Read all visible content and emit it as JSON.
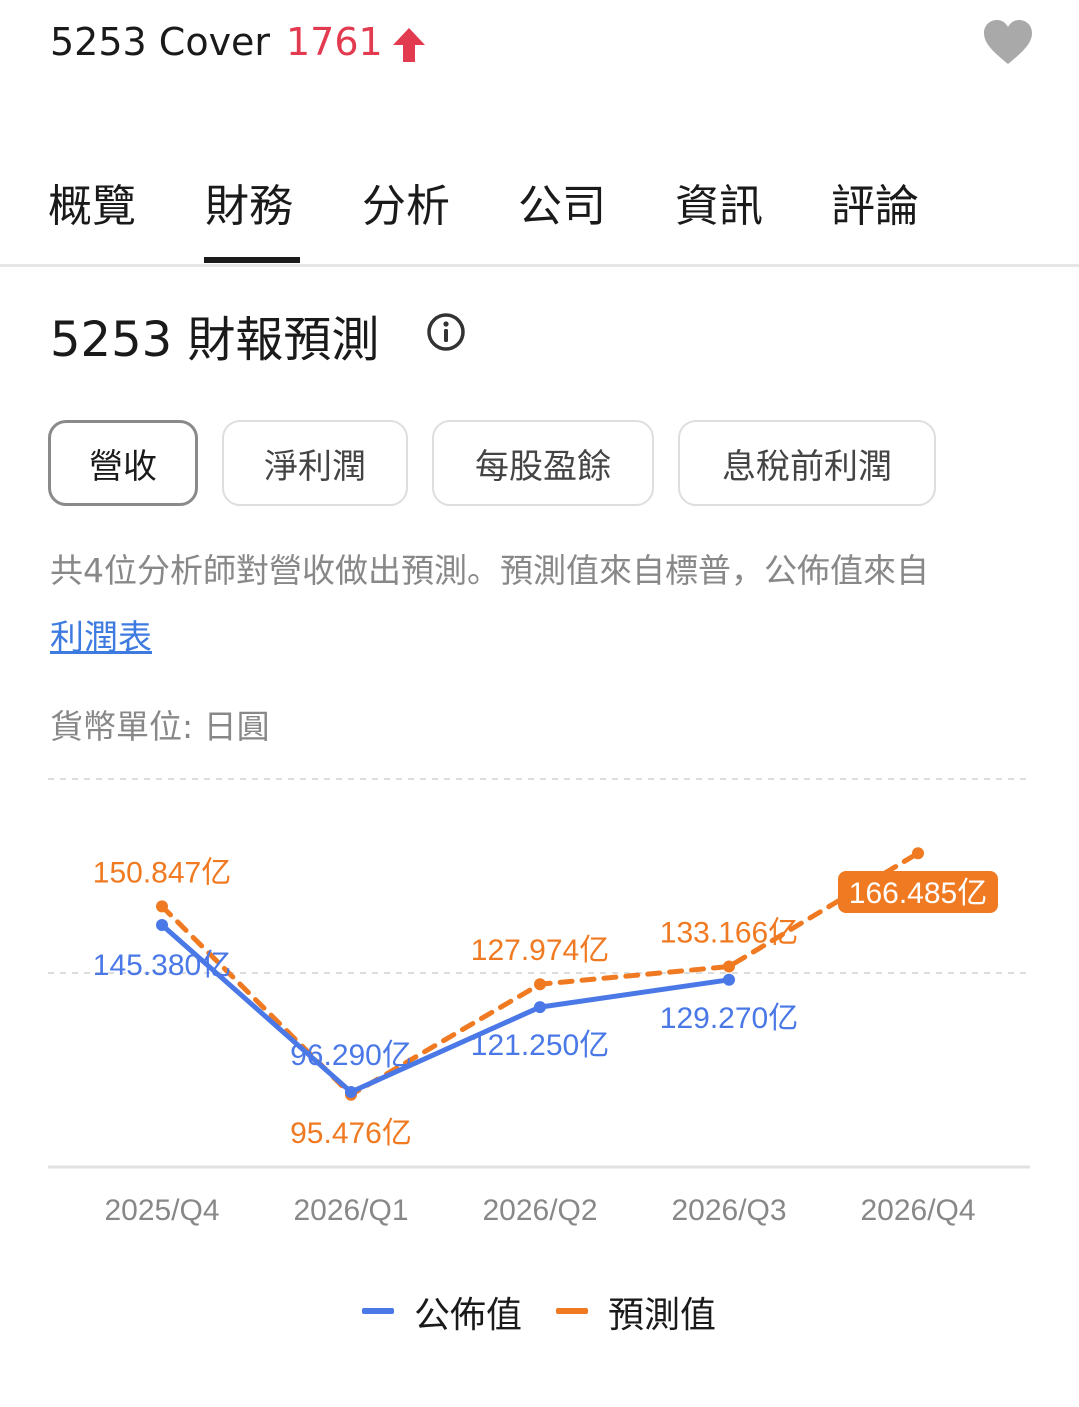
{
  "header": {
    "stock_name": "5253 Cover",
    "price": "1761",
    "price_color": "#e23a4f",
    "trend_icon": "arrow-up-icon",
    "favorite_icon": "heart-icon"
  },
  "tabs": [
    {
      "label": "概覽"
    },
    {
      "label": "財務"
    },
    {
      "label": "分析"
    },
    {
      "label": "公司"
    },
    {
      "label": "資訊"
    },
    {
      "label": "評論"
    }
  ],
  "active_tab": "財務",
  "section": {
    "title": "5253 財報預測",
    "info_icon": "info-icon"
  },
  "filters": [
    {
      "label": "營收"
    },
    {
      "label": "淨利潤"
    },
    {
      "label": "每股盈餘"
    },
    {
      "label": "息稅前利潤"
    }
  ],
  "active_filter": "營收",
  "description": "共4位分析師對營收做出預測。預測值來自標普，公佈值來自",
  "description_link": "利潤表",
  "currency": "貨幣單位: 日圓",
  "colors": {
    "actual": "#4a78e6",
    "forecast": "#f07a22"
  },
  "chart_data": {
    "type": "line",
    "categories": [
      "2025/Q4",
      "2026/Q1",
      "2026/Q2",
      "2026/Q3",
      "2026/Q4"
    ],
    "series": [
      {
        "name": "公佈值",
        "values": [
          145.38,
          96.29,
          121.25,
          129.27,
          null
        ],
        "labels": [
          "145.380亿",
          "96.290亿",
          "121.250亿",
          "129.270亿",
          null
        ]
      },
      {
        "name": "預測值",
        "values": [
          150.847,
          95.476,
          127.974,
          133.166,
          166.485
        ],
        "labels": [
          "150.847亿",
          "95.476亿",
          "127.974亿",
          "133.166亿",
          "166.485亿"
        ]
      }
    ],
    "unit": "亿",
    "ylim": [
      60,
      180
    ],
    "grid": true,
    "legend_position": "bottom"
  }
}
